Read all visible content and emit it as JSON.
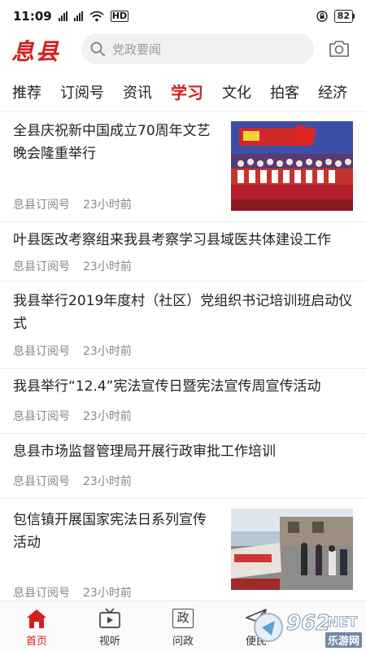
{
  "status_bar": {
    "time": "11:09",
    "network_label": "HD",
    "battery": "82"
  },
  "header": {
    "logo": "息县",
    "search_placeholder": "党政要闻"
  },
  "tabs": [
    {
      "label": "推荐",
      "active": false
    },
    {
      "label": "订阅号",
      "active": false
    },
    {
      "label": "资讯",
      "active": false
    },
    {
      "label": "学习",
      "active": true
    },
    {
      "label": "文化",
      "active": false
    },
    {
      "label": "拍客",
      "active": false
    },
    {
      "label": "经济",
      "active": false
    }
  ],
  "articles": [
    {
      "title": "全县庆祝新中国成立70周年文艺晚会隆重举行",
      "source": "息县订阅号",
      "time": "23小时前",
      "has_image": true
    },
    {
      "title": "叶县医改考察组来我县考察学习县域医共体建设工作",
      "source": "息县订阅号",
      "time": "23小时前",
      "has_image": false
    },
    {
      "title": "我县举行2019年度村（社区）党组织书记培训班启动仪式",
      "source": "息县订阅号",
      "time": "23小时前",
      "has_image": false
    },
    {
      "title": "我县举行“12.4”宪法宣传日暨宪法宣传周宣传活动",
      "source": "息县订阅号",
      "time": "23小时前",
      "has_image": false
    },
    {
      "title": "息县市场监督管理局开展行政审批工作培训",
      "source": "息县订阅号",
      "time": "23小时前",
      "has_image": false
    },
    {
      "title": "包信镇开展国家宪法日系列宣传活动",
      "source": "息县订阅号",
      "time": "23小时前",
      "has_image": true
    }
  ],
  "bottom_nav": [
    {
      "label": "首页",
      "icon": "home-icon",
      "active": true
    },
    {
      "label": "视听",
      "icon": "tv-icon",
      "active": false
    },
    {
      "label": "问政",
      "icon": "zheng-icon",
      "glyph": "政",
      "active": false
    },
    {
      "label": "便民",
      "icon": "send-icon",
      "active": false
    }
  ],
  "watermark": {
    "brand": "962",
    "suffix": "NET",
    "subtitle": "乐游网"
  },
  "colors": {
    "accent": "#d41f1f",
    "text": "#222222",
    "meta": "#888888",
    "divider": "#ececec"
  }
}
